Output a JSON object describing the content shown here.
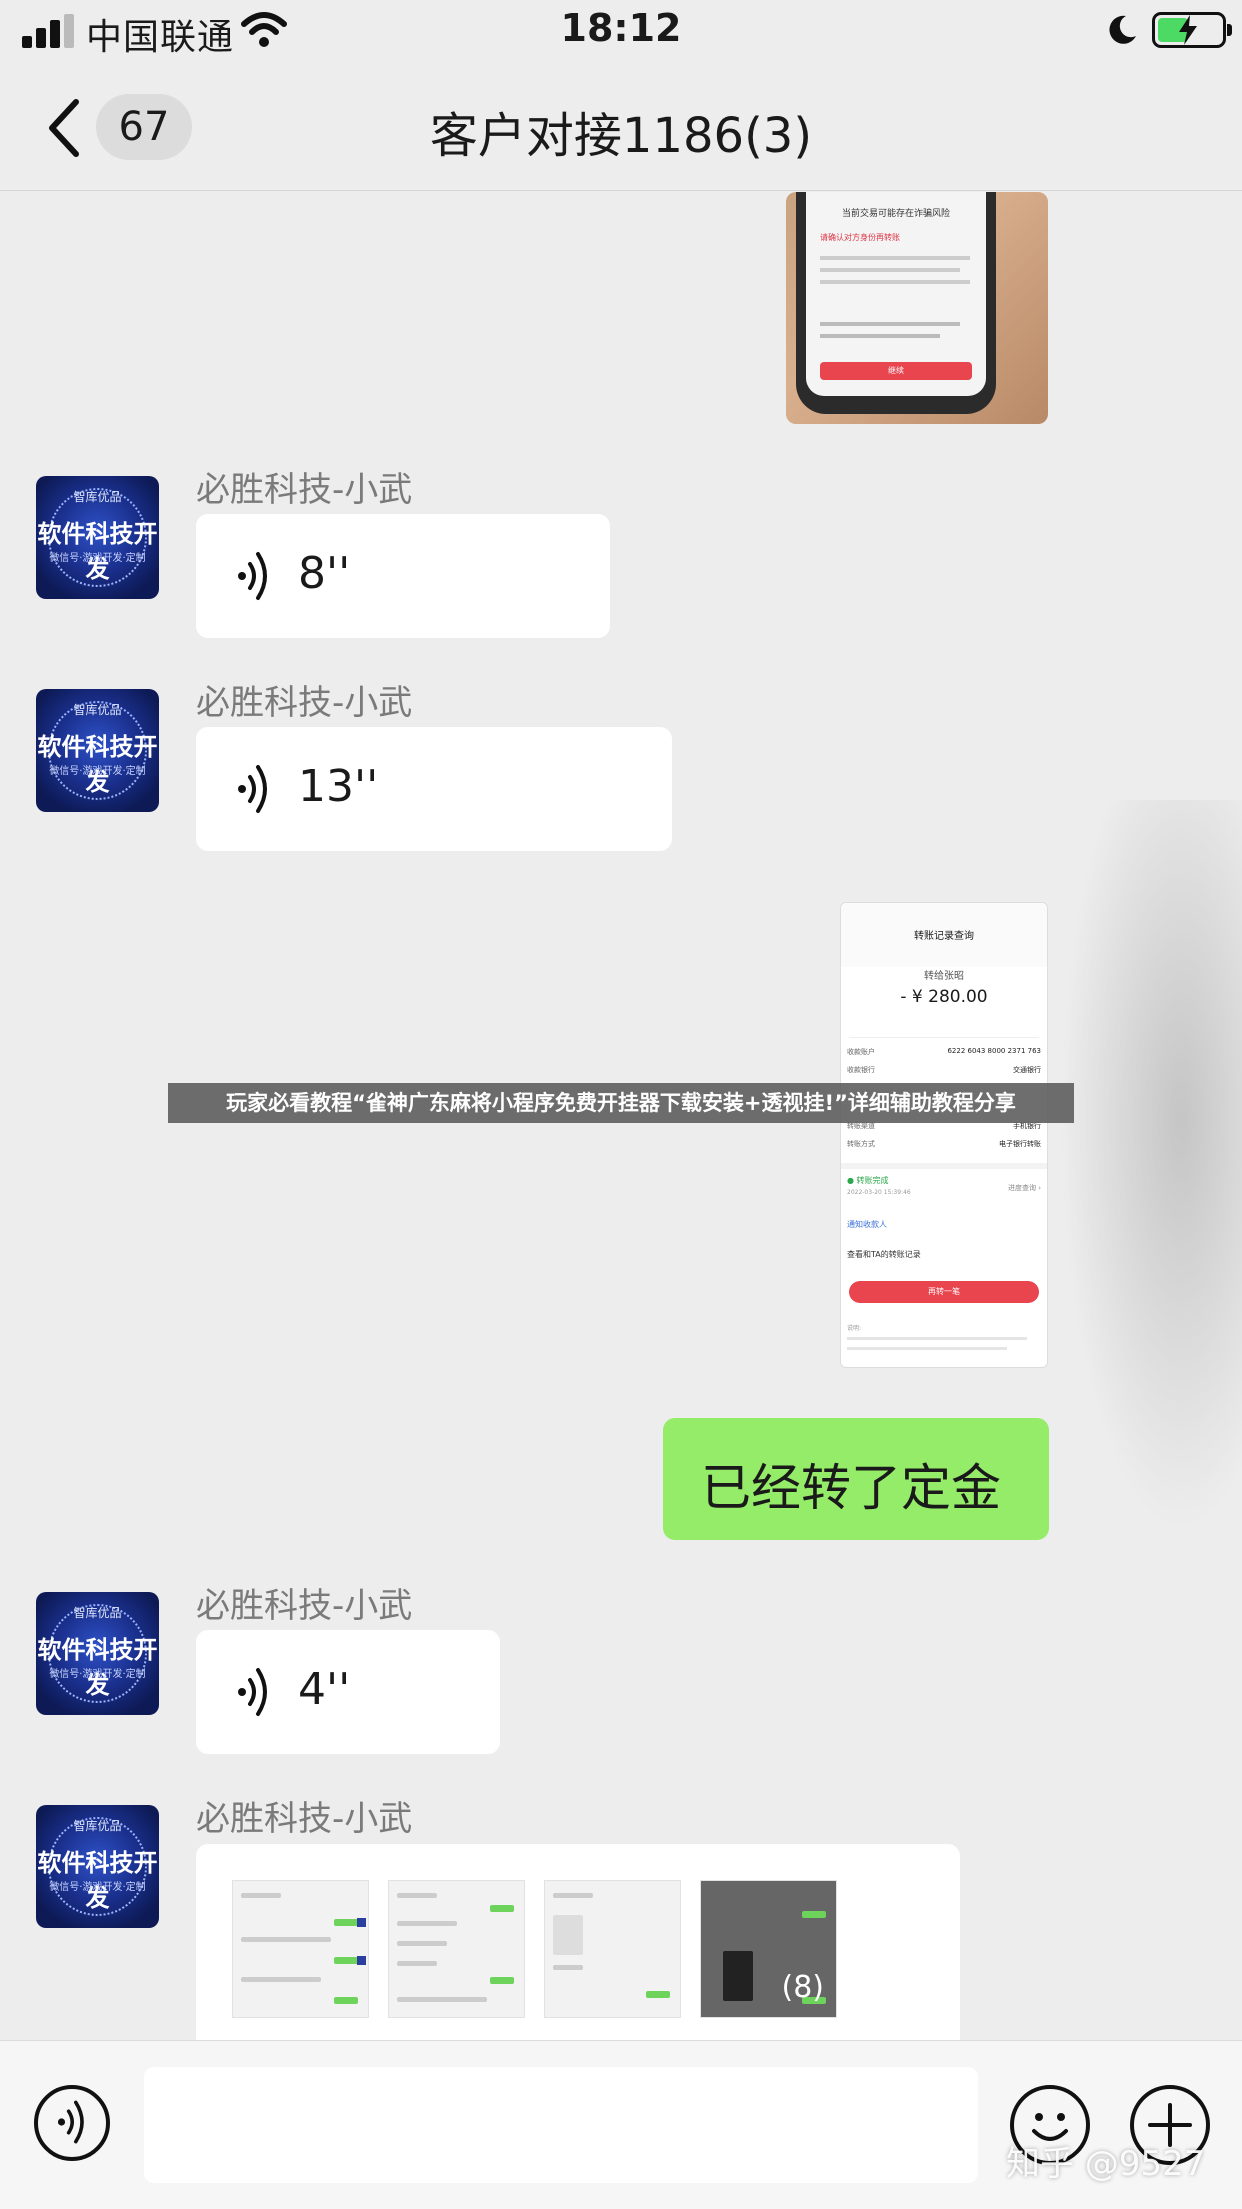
{
  "status_bar": {
    "carrier": "中国联通",
    "time": "18:12"
  },
  "nav": {
    "unread_count": "67",
    "title": "客户对接1186(3)"
  },
  "messages": [
    {
      "sender": "必胜科技-小武",
      "duration": "8''"
    },
    {
      "sender": "必胜科技-小武",
      "duration": "13''"
    },
    {
      "text": "已经转了定金"
    },
    {
      "sender": "必胜科技-小武",
      "duration": "4''"
    },
    {
      "sender": "必胜科技-小武",
      "more_badge": "(8)"
    }
  ],
  "avatar": {
    "top": "智库优品",
    "main": "软件科技开发",
    "bottom": "微信号·游戏开发·定制"
  },
  "transfer_screenshot": {
    "header": "转账记录查询",
    "label": "转给张昭",
    "amount": "- ¥ 280.00",
    "rows": [
      {
        "k": "收款账户",
        "v": "6222 6043 8000 2371 763"
      },
      {
        "k": "收款银行",
        "v": "交通银行"
      },
      {
        "k": "转账渠道",
        "v": "手机银行"
      },
      {
        "k": "转账方式",
        "v": "电子银行转账"
      }
    ],
    "status": "● 转账完成",
    "status_date": "2022-03-20 15:39:46",
    "status_right": "进度查询 ›",
    "link1": "通知收款人",
    "link2": "查看和TA的转账记录",
    "button": "再转一笔",
    "note": "说明:"
  },
  "phone_photo": {
    "title": "当前交易可能存在诈骗风险",
    "warn": "请确认对方身份再转账",
    "button": "继续"
  },
  "banner": "玩家必看教程“雀神广东麻将小程序免费开挂器下载安装+透视挂!”详细辅助教程分享",
  "watermark": "知乎 @9527",
  "colors": {
    "background": "#ededed",
    "my_bubble": "#95ec69",
    "bubble": "#ffffff",
    "red_button": "#e8454f"
  }
}
